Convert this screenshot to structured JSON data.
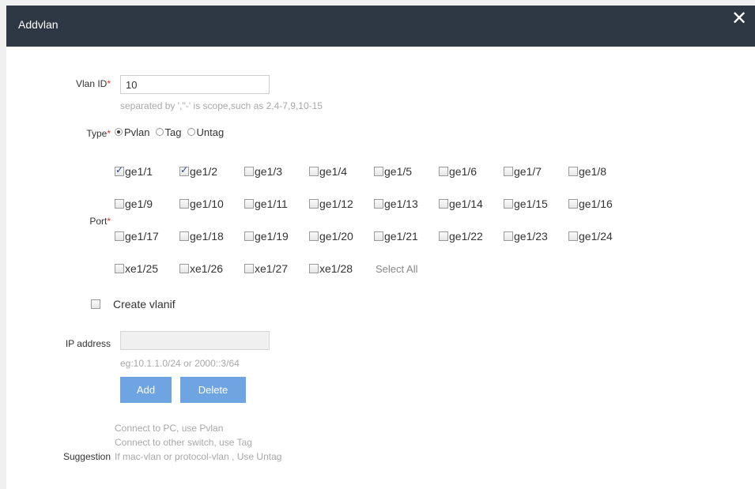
{
  "dialog": {
    "title": "Addvlan",
    "close_symbol": "✕"
  },
  "vlan_id": {
    "label": "Vlan ID",
    "required_mark": "*",
    "value": "10",
    "hint": "separated by ',''-' is scope,such as 2,4-7,9,10-15"
  },
  "type": {
    "label": "Type",
    "required_mark": "*",
    "options": [
      {
        "label": "Pvlan",
        "selected": true
      },
      {
        "label": "Tag",
        "selected": false
      },
      {
        "label": "Untag",
        "selected": false
      }
    ]
  },
  "port": {
    "label": "Port",
    "required_mark": "*",
    "rows": [
      [
        {
          "name": "ge1/1",
          "checked": true
        },
        {
          "name": "ge1/2",
          "checked": true
        },
        {
          "name": "ge1/3",
          "checked": false
        },
        {
          "name": "ge1/4",
          "checked": false
        },
        {
          "name": "ge1/5",
          "checked": false
        },
        {
          "name": "ge1/6",
          "checked": false
        },
        {
          "name": "ge1/7",
          "checked": false
        },
        {
          "name": "ge1/8",
          "checked": false
        }
      ],
      [
        {
          "name": "ge1/9",
          "checked": false
        },
        {
          "name": "ge1/10",
          "checked": false
        },
        {
          "name": "ge1/11",
          "checked": false
        },
        {
          "name": "ge1/12",
          "checked": false
        },
        {
          "name": "ge1/13",
          "checked": false
        },
        {
          "name": "ge1/14",
          "checked": false
        },
        {
          "name": "ge1/15",
          "checked": false
        },
        {
          "name": "ge1/16",
          "checked": false
        }
      ],
      [
        {
          "name": "ge1/17",
          "checked": false
        },
        {
          "name": "ge1/18",
          "checked": false
        },
        {
          "name": "ge1/19",
          "checked": false
        },
        {
          "name": "ge1/20",
          "checked": false
        },
        {
          "name": "ge1/21",
          "checked": false
        },
        {
          "name": "ge1/22",
          "checked": false
        },
        {
          "name": "ge1/23",
          "checked": false
        },
        {
          "name": "ge1/24",
          "checked": false
        }
      ],
      [
        {
          "name": "xe1/25",
          "checked": false
        },
        {
          "name": "xe1/26",
          "checked": false
        },
        {
          "name": "xe1/27",
          "checked": false
        },
        {
          "name": "xe1/28",
          "checked": false
        }
      ]
    ],
    "select_all_label": "Select All"
  },
  "create_vlanif": {
    "label": "Create vlanif",
    "checked": false
  },
  "ip_address": {
    "label": "IP address",
    "value": "",
    "disabled": true,
    "hint": "eg:10.1.1.0/24 or 2000::3/64"
  },
  "buttons": {
    "add": "Add",
    "delete": "Delete"
  },
  "suggestion": {
    "label": "Suggestion",
    "lines": [
      "Connect to PC, use Pvlan",
      "Connect to other switch, use Tag",
      "If mac-vlan or protocol-vlan , Use Untag"
    ]
  },
  "colors": {
    "titlebar": "#2e3744",
    "button": "#6fa4e2",
    "required": "#e0302a"
  }
}
